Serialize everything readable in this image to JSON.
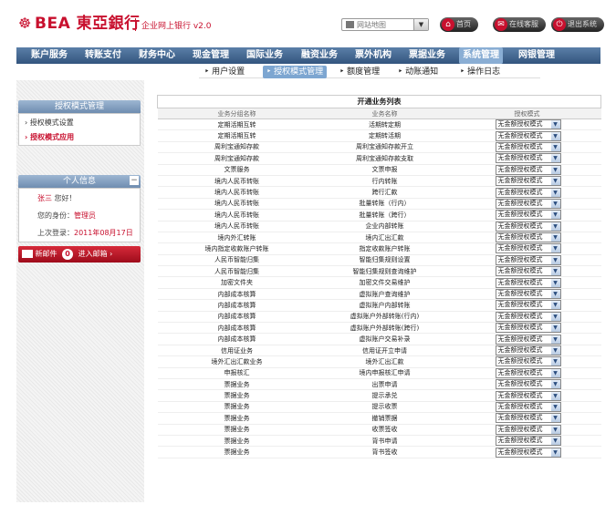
{
  "brand": {
    "logo_glyph": "☸",
    "name": "BEA 東亞銀行",
    "subtitle": "企业网上银行 v2.0"
  },
  "header": {
    "site_map": "网站地图",
    "buttons": [
      {
        "label": "首页",
        "icon": "home-icon",
        "glyph": "⌂"
      },
      {
        "label": "在线客服",
        "icon": "chat-icon",
        "glyph": "✉"
      },
      {
        "label": "退出系统",
        "icon": "logout-icon",
        "glyph": "⏻"
      }
    ]
  },
  "nav": {
    "items": [
      "账户服务",
      "转账支付",
      "财务中心",
      "现金管理",
      "国际业务",
      "融资业务",
      "票外机构",
      "票据业务",
      "系统管理",
      "网银管理"
    ],
    "active": "系统管理",
    "sub": [
      "用户设置",
      "授权模式管理",
      "额度管理",
      "动账通知",
      "操作日志"
    ],
    "sub_active": "授权模式管理"
  },
  "sidebar": {
    "auth_title": "授权模式管理",
    "links": [
      "授权模式设置",
      "授权模式应用"
    ],
    "active_link": "授权模式应用",
    "info_title": "个人信息",
    "greeting_name": "张三",
    "greeting": "您好！",
    "role_label": "您的身份：",
    "role": "管理员",
    "last_login_label": "上次登录：",
    "last_login": "2011年08月17日",
    "mail_label": "新邮件",
    "mail_count": "0",
    "mail_link": "进入邮箱 ›"
  },
  "table": {
    "title": "开通业务列表",
    "headers": [
      "业务分组名称",
      "业务名称",
      "授权模式"
    ],
    "mode": "无金额授权模式",
    "rows": [
      [
        "定期活期互转",
        "活期转定期"
      ],
      [
        "定期活期互转",
        "定期转活期"
      ],
      [
        "周利宝通知存款",
        "周利宝通知存款开立"
      ],
      [
        "周利宝通知存款",
        "周利宝通知存款支取"
      ],
      [
        "文票服务",
        "文票申报"
      ],
      [
        "境内人民币转账",
        "行内转账"
      ],
      [
        "境内人民币转账",
        "跨行汇款"
      ],
      [
        "境内人民币转账",
        "批量转账（行内）"
      ],
      [
        "境内人民币转账",
        "批量转账（跨行）"
      ],
      [
        "境内人民币转账",
        "企业内部转账"
      ],
      [
        "境内外汇转账",
        "境内汇出汇款"
      ],
      [
        "境内指定收款账户转账",
        "指定收款账户转账"
      ],
      [
        "人民币智能归集",
        "智能归集规则设置"
      ],
      [
        "人民币智能归集",
        "智能归集规则查询维护"
      ],
      [
        "加密文件夹",
        "加密文件交易维护"
      ],
      [
        "内部成本核算",
        "虚拟账户查询维护"
      ],
      [
        "内部成本核算",
        "虚拟账户内部转账"
      ],
      [
        "内部成本核算",
        "虚拟账户外部转账(行内)"
      ],
      [
        "内部成本核算",
        "虚拟账户外部转账(跨行)"
      ],
      [
        "内部成本核算",
        "虚拟账户交易补录"
      ],
      [
        "信用证业务",
        "信用证开立申请"
      ],
      [
        "境外汇出汇款业务",
        "境外汇出汇款"
      ],
      [
        "申报核汇",
        "境内申报核汇申请"
      ],
      [
        "票据业务",
        "出票申请"
      ],
      [
        "票据业务",
        "提示承兑"
      ],
      [
        "票据业务",
        "提示收票"
      ],
      [
        "票据业务",
        "撤销票据"
      ],
      [
        "票据业务",
        "收票签收"
      ],
      [
        "票据业务",
        "背书申请"
      ],
      [
        "票据业务",
        "背书签收"
      ]
    ]
  }
}
